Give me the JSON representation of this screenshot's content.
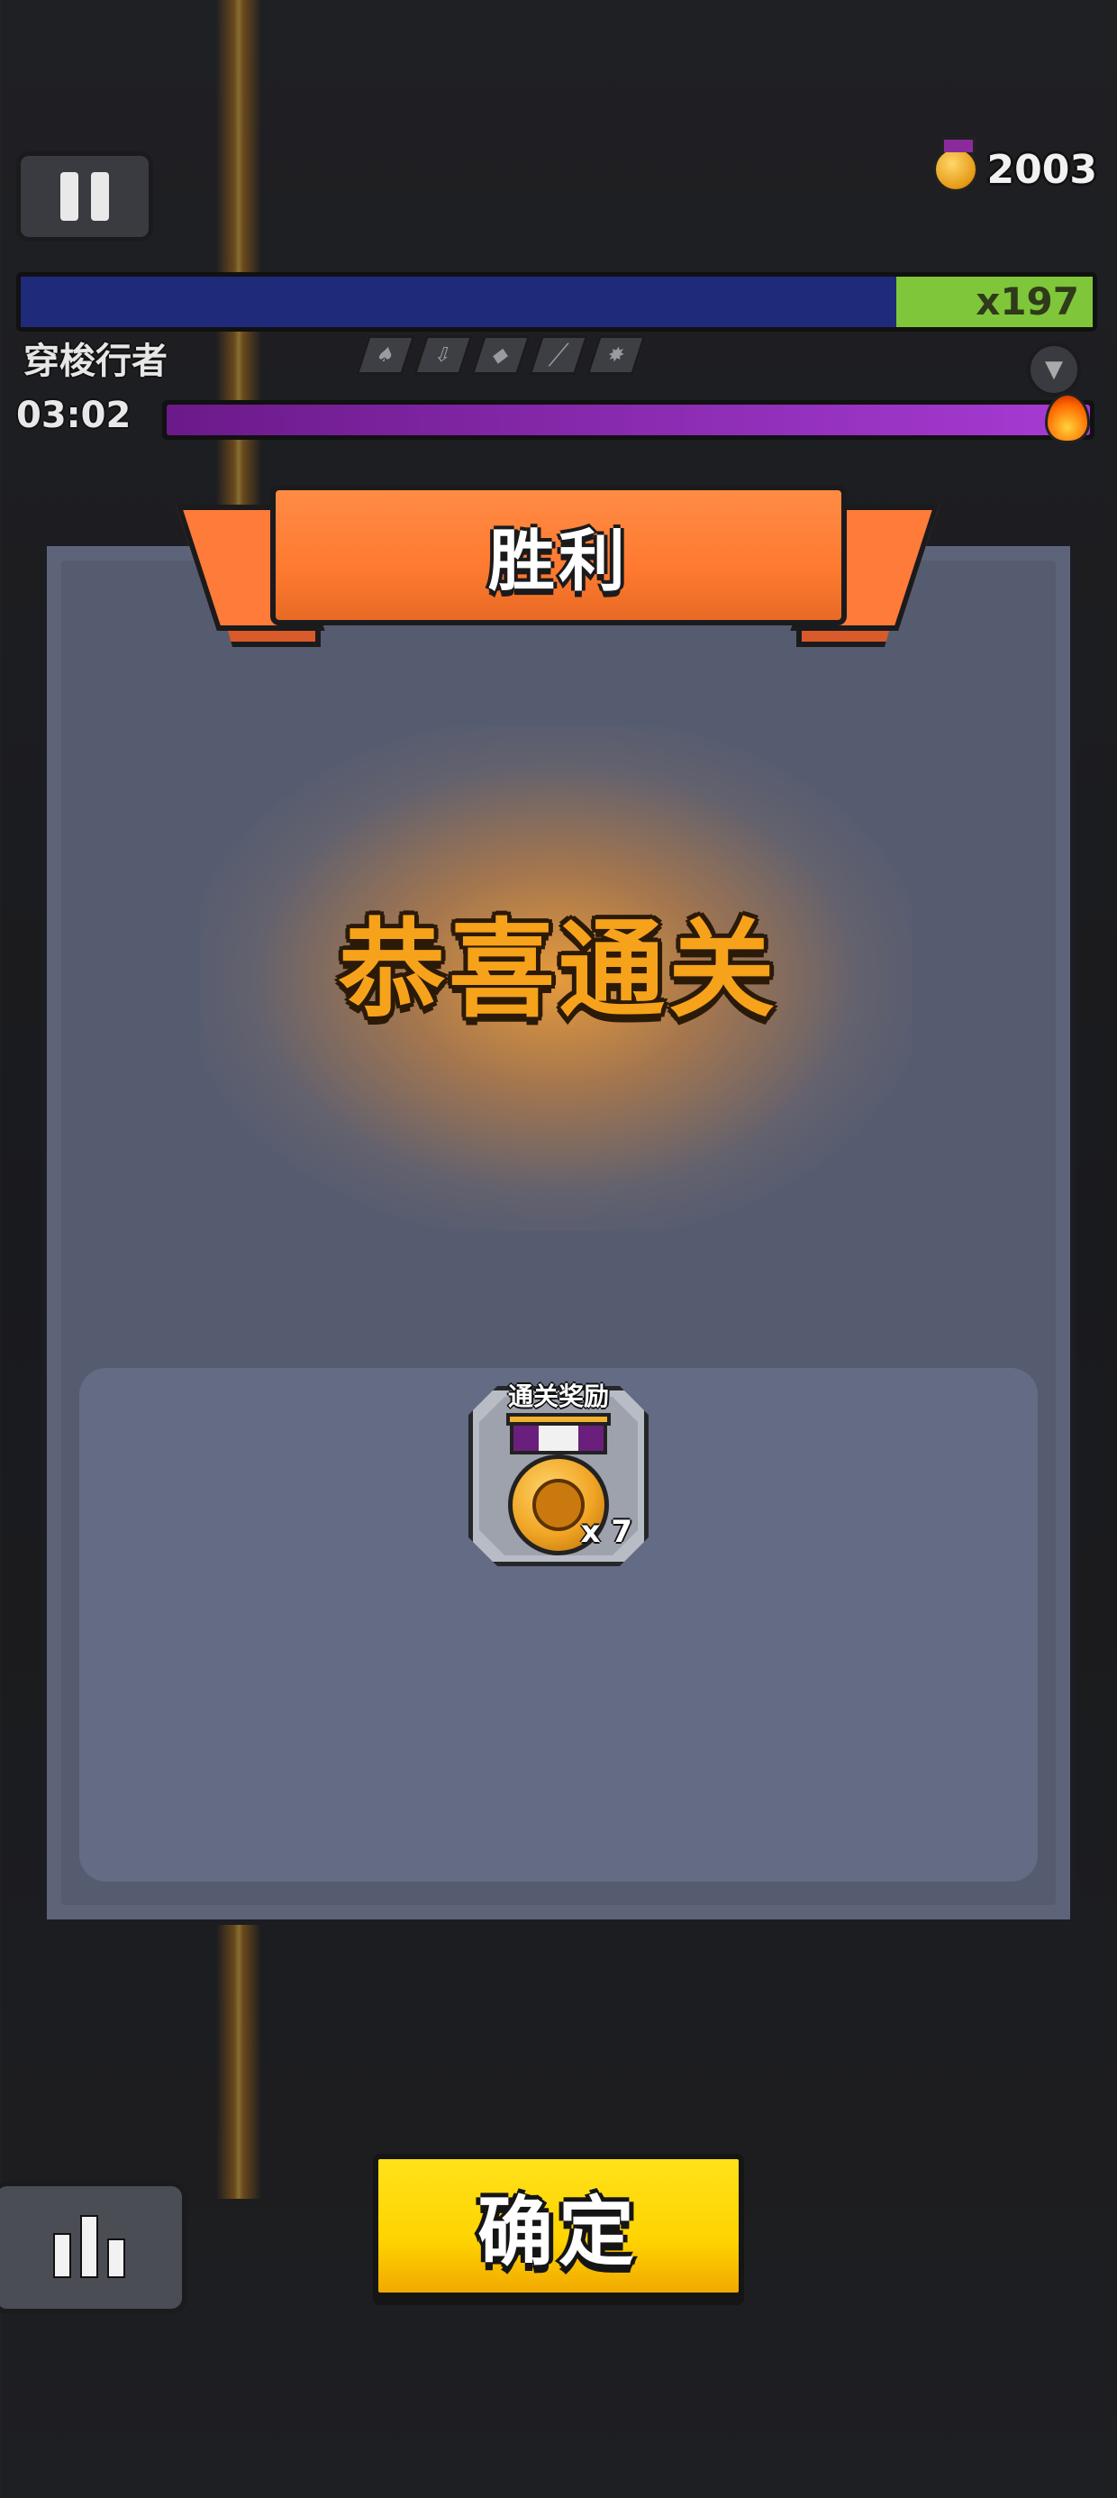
{
  "hud": {
    "score": "2003",
    "boss_multiplier": "x197",
    "boss_name": "穿梭行者",
    "timer": "03:02"
  },
  "dialog": {
    "title": "胜利",
    "message": "恭喜通关",
    "reward_label": "通关奖励",
    "reward_quantity": "x 7"
  },
  "buttons": {
    "confirm": "确定"
  },
  "colors": {
    "banner": "#ff7a30",
    "confirm_button": "#ffd400",
    "congrats_text": "#f7a21b",
    "panel": "#5d6479",
    "boss_hp_blue": "#1f2a7a",
    "boss_hp_green": "#7fc63a",
    "rage_bar": "#a73bd4"
  },
  "icons": [
    "pause-icon",
    "medal-icon",
    "fire-icon",
    "chevron-down-icon",
    "stats-icon"
  ]
}
